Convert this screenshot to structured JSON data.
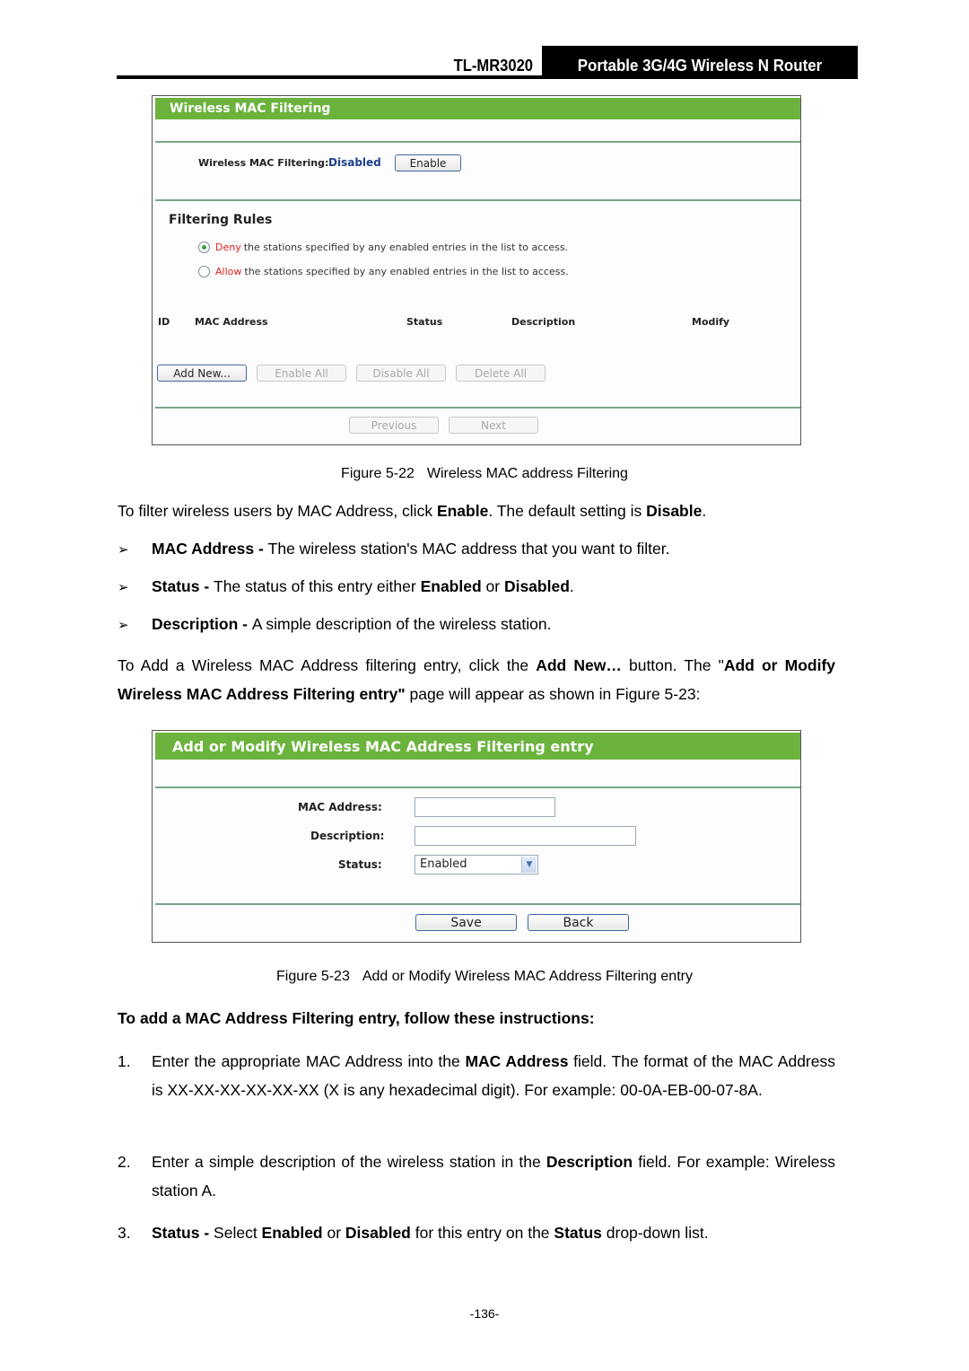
{
  "header": {
    "model": "TL-MR3020",
    "product": "Portable 3G/4G Wireless N Router"
  },
  "figure22": {
    "title": "Wireless MAC Filtering",
    "filtering_label": "Wireless MAC Filtering:",
    "filtering_status": "Disabled",
    "enable_button": "Enable",
    "rules_heading": "Filtering Rules",
    "rules": [
      {
        "keyword": "Deny",
        "text": "the stations specified by any enabled entries in the list to access.",
        "checked": true
      },
      {
        "keyword": "Allow",
        "text": "the stations specified by any enabled entries in the list to access.",
        "checked": false
      }
    ],
    "columns": [
      "ID",
      "MAC Address",
      "Status",
      "Description",
      "Modify"
    ],
    "buttons": {
      "add_new": "Add New...",
      "enable_all": "Enable All",
      "disable_all": "Disable All",
      "delete_all": "Delete All",
      "previous": "Previous",
      "next": "Next"
    },
    "caption_num": "Figure 5-22",
    "caption_text": "Wireless MAC address Filtering"
  },
  "body": {
    "intro": {
      "t1": "To filter wireless users by MAC Address, click ",
      "b1": "Enable",
      "t2": ". The default setting is ",
      "b2": "Disable",
      "t3": "."
    },
    "bullets": [
      {
        "term": "MAC Address - ",
        "desc": "The wireless station's MAC address that you want to filter."
      },
      {
        "term": "Status - ",
        "desc": "The status of this entry either ",
        "b1": "Enabled",
        "mid": " or ",
        "b2": "Disabled",
        "end": "."
      },
      {
        "term": "Description - ",
        "desc": "A simple description of the wireless station."
      }
    ],
    "addnew_para": {
      "t1": "To Add a Wireless MAC Address filtering entry, click the ",
      "b1": "Add New…",
      "t2": " button. The \"",
      "b2": "Add or Modify Wireless MAC Address Filtering entry\"",
      "t3": " page will appear as shown in Figure 5-23:"
    }
  },
  "figure23": {
    "title": "Add or Modify Wireless MAC Address Filtering entry",
    "mac_label": "MAC Address:",
    "mac_value": "",
    "desc_label": "Description:",
    "desc_value": "",
    "status_label": "Status:",
    "status_selected": "Enabled",
    "save_button": "Save",
    "back_button": "Back",
    "caption_num": "Figure 5-23",
    "caption_text": "Add or Modify Wireless MAC Address Filtering entry"
  },
  "instructions": {
    "heading": "To add a MAC Address Filtering entry, follow these instructions:",
    "items": [
      {
        "n": "1.",
        "t1": "Enter the appropriate MAC Address into the ",
        "b1": "MAC Address",
        "t2": " field. The format of the MAC Address is XX-XX-XX-XX-XX-XX (X is any hexadecimal digit). For example: 00-0A-EB-00-07-8A."
      },
      {
        "n": "2.",
        "t1": "Enter a simple description of the wireless station in the ",
        "b1": "Description",
        "t2": " field. For example: Wireless station A."
      },
      {
        "n": "3.",
        "b0": "Status - ",
        "t1": "Select ",
        "b1": "Enabled",
        "t2": " or ",
        "b2": "Disabled",
        "t3": " for this entry on the ",
        "b3": "Status",
        "t4": " drop-down list."
      }
    ]
  },
  "page_number": "-136-"
}
